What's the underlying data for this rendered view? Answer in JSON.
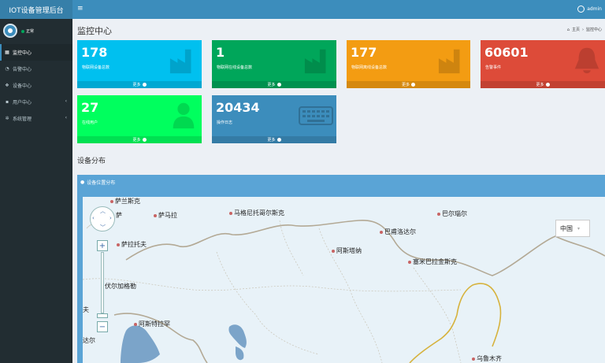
{
  "brand": "IOT设备管理后台",
  "topbar": {
    "toggle_icon": "hamburger-icon",
    "user": "admin"
  },
  "sidebar": {
    "status": "正常",
    "items": [
      {
        "label": "监控中心",
        "icon": "dashboard-icon",
        "active": true
      },
      {
        "label": "告警中心",
        "icon": "bell-icon"
      },
      {
        "label": "设备中心",
        "icon": "devices-icon"
      },
      {
        "label": "用户中心",
        "icon": "user-icon",
        "has_children": true
      },
      {
        "label": "系统管理",
        "icon": "gear-icon",
        "has_children": true
      }
    ]
  },
  "header": {
    "title": "监控中心",
    "breadcrumb": [
      "主页",
      "监控中心"
    ]
  },
  "stats": [
    {
      "value": "178",
      "label": "物联网设备总数",
      "more": "更多",
      "color": "#00c0ef",
      "icon": "factory-icon"
    },
    {
      "value": "1",
      "label": "物联网在线设备总数",
      "more": "更多",
      "color": "#00a65a",
      "icon": "factory-icon"
    },
    {
      "value": "177",
      "label": "物联网离线设备总数",
      "more": "更多",
      "color": "#f39c12",
      "icon": "factory-icon"
    },
    {
      "value": "60601",
      "label": "告警事件",
      "more": "更多",
      "color": "#dd4b39",
      "icon": "bell-icon"
    },
    {
      "value": "27",
      "label": "在线用户",
      "more": "更多",
      "color": "#00ff5e",
      "icon": "person-icon"
    },
    {
      "value": "20434",
      "label": "操作日志",
      "more": "更多",
      "color": "#3c8dbc",
      "icon": "keyboard-icon"
    }
  ],
  "section": {
    "title": "设备分布"
  },
  "map_panel": {
    "title": "设备位置分布",
    "country": "中国",
    "cities": [
      "萨兰斯克",
      "萨马拉",
      "马格尼托哥尔斯克",
      "巴尔瑙尔",
      "巴甫洛达尔",
      "萨拉托夫",
      "阿斯塔纳",
      "塞米巴拉金斯克",
      "伏尔加格勒",
      "阿斯特拉罕",
      "乌鲁木齐"
    ],
    "edge_labels": [
      "萨",
      "夫",
      "达尔"
    ]
  }
}
